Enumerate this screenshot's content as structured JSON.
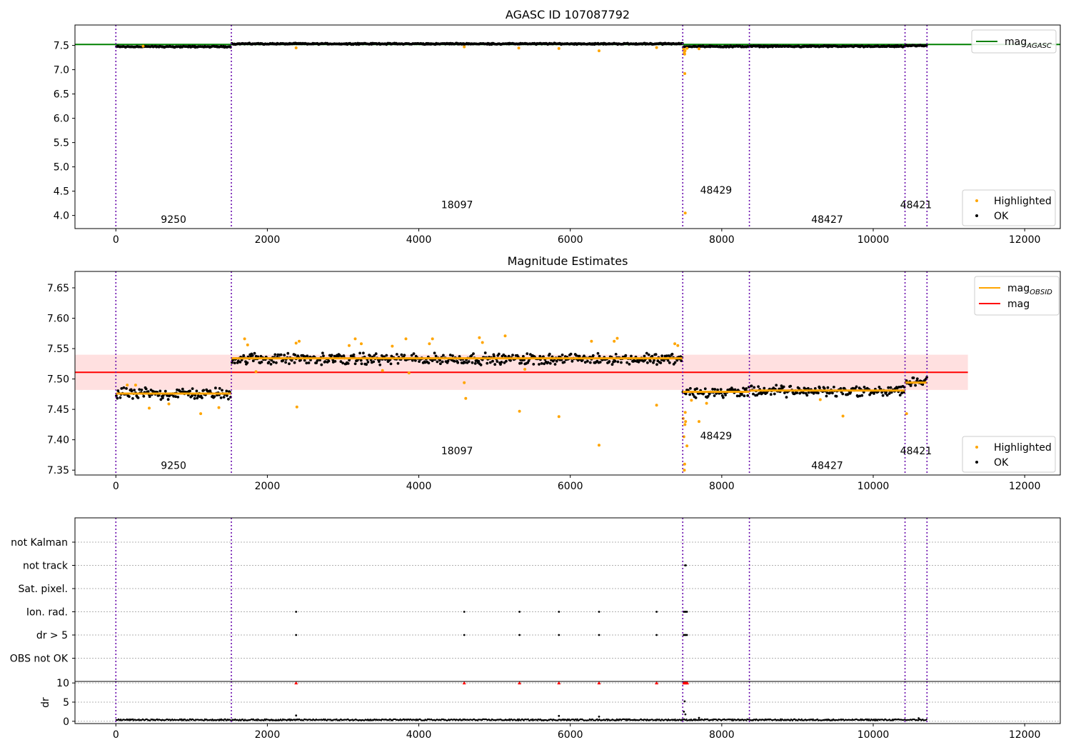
{
  "figure": {
    "obs_boundaries": [
      0,
      1525,
      7485,
      8365,
      10420,
      10710
    ],
    "obs_labels": [
      {
        "label": "9250",
        "x": 762
      },
      {
        "label": "18097",
        "x": 4505
      },
      {
        "label": "48429",
        "x": 7925
      },
      {
        "label": "48427",
        "x": 9392
      },
      {
        "label": "48421",
        "x": 10565
      }
    ]
  },
  "chart_data": [
    {
      "type": "scatter",
      "title": "AGASC ID 107087792",
      "xlim": [
        -540,
        12470
      ],
      "ylim": [
        3.73,
        7.92
      ],
      "xticks": [
        0,
        2000,
        4000,
        6000,
        8000,
        10000,
        12000
      ],
      "yticks": [
        4.0,
        4.5,
        5.0,
        5.5,
        6.0,
        6.5,
        7.0,
        7.5
      ],
      "yticklabels": [
        "4.0",
        "4.5",
        "5.0",
        "5.5",
        "6.0",
        "6.5",
        "7.0",
        "7.5"
      ],
      "label_y": [
        3.85,
        4.15,
        4.45,
        3.85,
        4.15
      ],
      "legend_lines": [
        {
          "name": "mag",
          "subscript": "AGASC",
          "color": "#008000"
        }
      ],
      "legend_points": [
        {
          "name": "Highlighted",
          "color": "#ffa500"
        },
        {
          "name": "OK",
          "color": "#000000"
        }
      ],
      "hlines": [
        {
          "name": "mag_AGASC",
          "y": 7.52,
          "color": "#008000"
        }
      ],
      "ok_points": {
        "segments": [
          [
            0,
            1525,
            7.474
          ],
          [
            1525,
            7485,
            7.533
          ],
          [
            7485,
            8365,
            7.478
          ],
          [
            8365,
            10420,
            7.48
          ],
          [
            10420,
            10710,
            7.494
          ]
        ],
        "jitter": 0.016
      },
      "highlighted_points": [
        [
          360,
          7.485
        ],
        [
          2380,
          7.45
        ],
        [
          4600,
          7.47
        ],
        [
          5320,
          7.445
        ],
        [
          5850,
          7.437
        ],
        [
          6380,
          7.39
        ],
        [
          7140,
          7.455
        ],
        [
          7498,
          7.42
        ],
        [
          7505,
          7.35
        ],
        [
          7510,
          7.32
        ],
        [
          7512,
          6.92
        ],
        [
          7515,
          7.39
        ],
        [
          7518,
          4.05
        ],
        [
          7540,
          7.44
        ],
        [
          7700,
          7.43
        ]
      ]
    },
    {
      "type": "scatter",
      "title": "Magnitude Estimates",
      "xlim": [
        -540,
        12470
      ],
      "ylim": [
        7.342,
        7.677
      ],
      "xticks": [
        0,
        2000,
        4000,
        6000,
        8000,
        10000,
        12000
      ],
      "yticks": [
        7.35,
        7.4,
        7.45,
        7.5,
        7.55,
        7.6,
        7.65
      ],
      "yticklabels": [
        "7.35",
        "7.40",
        "7.45",
        "7.50",
        "7.55",
        "7.60",
        "7.65"
      ],
      "label_y": [
        7.352,
        7.376,
        7.401,
        7.352,
        7.376
      ],
      "legend_lines": [
        {
          "name": "mag",
          "subscript": "OBSID",
          "color": "#ffa500"
        },
        {
          "name": "mag",
          "subscript": "",
          "color": "#ff0000"
        }
      ],
      "legend_points": [
        {
          "name": "Highlighted",
          "color": "#ffa500"
        },
        {
          "name": "OK",
          "color": "#000000"
        }
      ],
      "mag": {
        "value": 7.511,
        "band": [
          7.482,
          7.54
        ],
        "x_range": [
          -540,
          11250
        ]
      },
      "obs_mags": [
        {
          "x": [
            0,
            1525
          ],
          "y": 7.476
        },
        {
          "x": [
            1525,
            7485
          ],
          "y": 7.534
        },
        {
          "x": [
            7485,
            8365
          ],
          "y": 7.479
        },
        {
          "x": [
            8365,
            10420
          ],
          "y": 7.481
        },
        {
          "x": [
            10420,
            10710
          ],
          "y": 7.494
        }
      ],
      "ok_points": {
        "segments": [
          [
            0,
            1525,
            7.476
          ],
          [
            1525,
            7485,
            7.533
          ],
          [
            7485,
            8365,
            7.478
          ],
          [
            8365,
            10420,
            7.48
          ],
          [
            10420,
            10710,
            7.496
          ]
        ],
        "jitter": 0.011
      },
      "highlighted_points": [
        [
          150,
          7.49
        ],
        [
          260,
          7.49
        ],
        [
          440,
          7.452
        ],
        [
          700,
          7.459
        ],
        [
          1120,
          7.443
        ],
        [
          1360,
          7.453
        ],
        [
          1700,
          7.566
        ],
        [
          1740,
          7.556
        ],
        [
          1850,
          7.512
        ],
        [
          2380,
          7.559
        ],
        [
          2390,
          7.454
        ],
        [
          2420,
          7.562
        ],
        [
          3080,
          7.555
        ],
        [
          3160,
          7.566
        ],
        [
          3240,
          7.558
        ],
        [
          3520,
          7.514
        ],
        [
          3650,
          7.554
        ],
        [
          3830,
          7.566
        ],
        [
          3870,
          7.51
        ],
        [
          4140,
          7.558
        ],
        [
          4180,
          7.566
        ],
        [
          4600,
          7.494
        ],
        [
          4620,
          7.468
        ],
        [
          4800,
          7.568
        ],
        [
          4840,
          7.56
        ],
        [
          5140,
          7.571
        ],
        [
          5330,
          7.447
        ],
        [
          5400,
          7.516
        ],
        [
          5850,
          7.438
        ],
        [
          6280,
          7.562
        ],
        [
          6380,
          7.391
        ],
        [
          6580,
          7.562
        ],
        [
          6620,
          7.567
        ],
        [
          7140,
          7.457
        ],
        [
          7380,
          7.558
        ],
        [
          7420,
          7.555
        ],
        [
          7490,
          7.435
        ],
        [
          7500,
          7.405
        ],
        [
          7506,
          7.35
        ],
        [
          7510,
          7.36
        ],
        [
          7514,
          7.425
        ],
        [
          7518,
          7.445
        ],
        [
          7522,
          7.43
        ],
        [
          7540,
          7.39
        ],
        [
          7600,
          7.465
        ],
        [
          7700,
          7.43
        ],
        [
          7800,
          7.46
        ],
        [
          9300,
          7.466
        ],
        [
          9600,
          7.439
        ],
        [
          10440,
          7.443
        ]
      ]
    },
    {
      "type": "scatter",
      "xlim": [
        -540,
        12470
      ],
      "ylim": [
        -0.6,
        6.5
      ],
      "xticks": [
        0,
        2000,
        4000,
        6000,
        8000,
        10000,
        12000
      ],
      "categories": [
        "not Kalman",
        "not track",
        "Sat. pixel.",
        "Ion. rad.",
        "dr > 5",
        "OBS not OK"
      ],
      "flags": [
        {
          "category": "not track",
          "x": [
            7516,
            7525
          ]
        },
        {
          "category": "Ion. rad.",
          "x": [
            2380,
            4600,
            5330,
            5850,
            6380,
            7140,
            7498,
            7512,
            7525,
            7540
          ]
        },
        {
          "category": "dr > 5",
          "x": [
            2380,
            4600,
            5330,
            5850,
            6380,
            7140,
            7498,
            7512,
            7525,
            7540
          ]
        }
      ]
    },
    {
      "type": "scatter",
      "xlim": [
        -540,
        12470
      ],
      "ylim": [
        -0.6,
        10.4
      ],
      "xticks": [
        0,
        2000,
        4000,
        6000,
        8000,
        10000,
        12000
      ],
      "xticklabels": [
        "0",
        "2000",
        "4000",
        "6000",
        "8000",
        "10000",
        "12000"
      ],
      "yticks": [
        0,
        5,
        10
      ],
      "yticklabels": [
        "0",
        "5",
        "10"
      ],
      "ylabel": "dr",
      "clipped_points": [
        2380,
        4600,
        5330,
        5850,
        6380,
        7140,
        7500,
        7515,
        7530,
        7545
      ],
      "dr_points": {
        "range": [
          0,
          10710
        ],
        "base": 0.2,
        "jitter": 0.35
      },
      "dr_outliers": [
        [
          2380,
          1.5
        ],
        [
          5850,
          1.4
        ],
        [
          6380,
          1.2
        ],
        [
          7500,
          2.5
        ],
        [
          7510,
          5.2
        ],
        [
          7520,
          1.8
        ],
        [
          7700,
          0.9
        ],
        [
          10600,
          0.8
        ]
      ]
    }
  ]
}
